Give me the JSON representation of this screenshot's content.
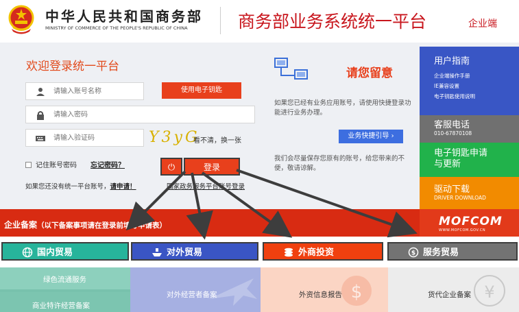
{
  "header": {
    "ministry_cn": "中华人民共和国商务部",
    "ministry_en": "MINISTRY OF COMMERCE OF THE PEOPLE'S REPUBLIC OF CHINA",
    "platform_title": "商务部业务系统统一平台",
    "platform_sub": "企业端"
  },
  "login": {
    "title": "欢迎登录统一平台",
    "account_placeholder": "请输入账号名称",
    "ekey_button": "使用电子钥匙",
    "password_placeholder": "请输入密码",
    "captcha_placeholder": "请输入验证码",
    "captcha_text": "Y3yG",
    "refresh_text": "看不清，换一张",
    "remember_label": "记住账号密码",
    "forgot_label": "忘记密码？",
    "login_button": "登录",
    "no_account_text": "如果您还没有统一平台账号，",
    "register_link": "请申请！",
    "gov_link": "国家政务服务平台账号登录"
  },
  "notice": {
    "title": "请您留意",
    "text1": "如果您已经有业务应用账号，请使用快捷登录功能进行业务办理。",
    "quick_button": "业务快捷引导  ›",
    "text2": "我们会尽量保存您原有的账号，给您带来的不便，敬请谅解。"
  },
  "side": {
    "guide_title": "用户指南",
    "guide_items": [
      "企业端操作手册",
      "IE兼容设置",
      "电子钥匙使用说明"
    ],
    "service_title": "客服电话",
    "service_phone": "010-67870108",
    "ekey_title_1": "电子钥匙申请",
    "ekey_title_2": "与更新",
    "driver_title": "驱动下载",
    "driver_sub": "DRIVER DOWNLOAD"
  },
  "band": {
    "title": "企业备案",
    "note": "（以下备案事项请在登录前填写申请表）",
    "mofcom": "MOFCOM",
    "mofcom_url": "WWW.MOFCOM.GOV.CN"
  },
  "categories": [
    {
      "label": "国内贸易",
      "color": "#27b49b",
      "icon": "globe-icon"
    },
    {
      "label": "对外贸易",
      "color": "#3a55c4",
      "icon": "ship-icon"
    },
    {
      "label": "外商投资",
      "color": "#f0400f",
      "icon": "coins-icon"
    },
    {
      "label": "服务贸易",
      "color": "#737373",
      "icon": "service-icon"
    }
  ],
  "subitems": {
    "domestic_1": "绿色流通服务",
    "domestic_2": "商业特许经营备案",
    "foreign_trade": "对外经营者备案",
    "foreign_invest": "外资信息报告",
    "service_trade": "货代企业备案"
  }
}
